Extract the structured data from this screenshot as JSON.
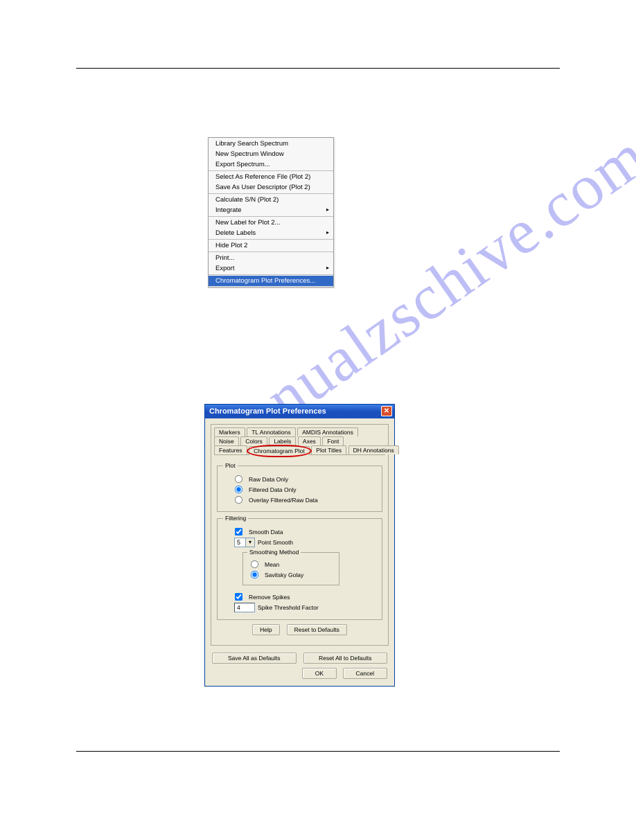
{
  "watermark": "manualzschive.com",
  "context_menu": {
    "groups": [
      [
        {
          "label": "Library Search Spectrum",
          "submenu": false
        },
        {
          "label": "New Spectrum Window",
          "submenu": false
        },
        {
          "label": "Export Spectrum...",
          "submenu": false
        }
      ],
      [
        {
          "label": "Select As Reference File (Plot 2)",
          "submenu": false
        },
        {
          "label": "Save As User Descriptor (Plot 2)",
          "submenu": false
        }
      ],
      [
        {
          "label": "Calculate S/N (Plot 2)",
          "submenu": false
        },
        {
          "label": "Integrate",
          "submenu": true
        }
      ],
      [
        {
          "label": "New Label for Plot 2...",
          "submenu": false
        },
        {
          "label": "Delete Labels",
          "submenu": true
        }
      ],
      [
        {
          "label": "Hide Plot 2",
          "submenu": false
        }
      ],
      [
        {
          "label": "Print...",
          "submenu": false
        },
        {
          "label": "Export",
          "submenu": true
        }
      ],
      [
        {
          "label": "Chromatogram Plot Preferences...",
          "submenu": false,
          "selected": true
        }
      ]
    ]
  },
  "dialog": {
    "title": "Chromatogram Plot Preferences",
    "tabs_row1": [
      "Markers",
      "TL Annotations",
      "AMDIS Annotations"
    ],
    "tabs_row2": [
      "Noise",
      "Colors",
      "Labels",
      "Axes",
      "Font"
    ],
    "tabs_row3": [
      "Features",
      "Chromatogram Plot",
      "Plot Titles",
      "DH Annotations"
    ],
    "active_tab": "Chromatogram Plot",
    "plot_group": {
      "legend": "Plot",
      "options": [
        "Raw Data Only",
        "Filtered Data Only",
        "Overlay Filtered/Raw Data"
      ],
      "selected": "Filtered Data Only"
    },
    "filtering_group": {
      "legend": "Filtering",
      "smooth_check": "Smooth Data",
      "smooth_checked": true,
      "point_smooth_value": "5",
      "point_smooth_label": "Point Smooth",
      "smoothing_method": {
        "legend": "Smoothing Method",
        "options": [
          "Mean",
          "Savitsky Golay"
        ],
        "selected": "Savitsky Golay"
      },
      "remove_spikes_check": "Remove Spikes",
      "remove_spikes_checked": true,
      "spike_value": "4",
      "spike_label": "Spike Threshold Factor"
    },
    "buttons": {
      "help": "Help",
      "reset": "Reset to Defaults",
      "save_all": "Save All as Defaults",
      "reset_all": "Reset All to Defaults",
      "ok": "OK",
      "cancel": "Cancel"
    }
  }
}
